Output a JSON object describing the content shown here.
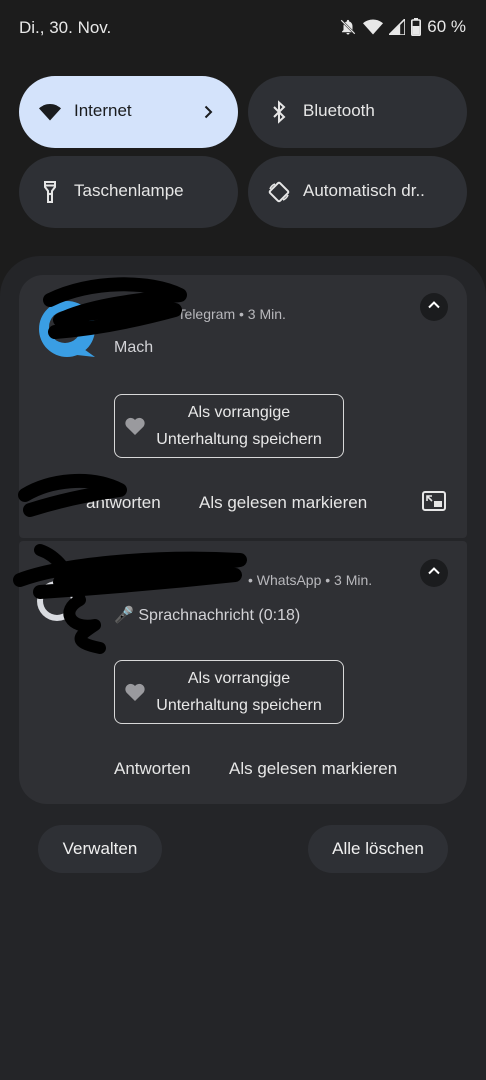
{
  "status_bar": {
    "date": "Di., 30. Nov.",
    "battery": "60 %",
    "icons": [
      "bell-off-icon",
      "wifi-icon",
      "cell-signal-icon",
      "battery-icon"
    ]
  },
  "quick_tiles": [
    {
      "label": "Internet",
      "icon": "wifi-icon",
      "active": true
    },
    {
      "label": "Bluetooth",
      "icon": "bluetooth-icon",
      "active": false
    },
    {
      "label": "Taschenlampe",
      "icon": "flashlight-icon",
      "active": false
    },
    {
      "label": "Automatisch dr..",
      "icon": "auto-rotate-icon",
      "active": false
    }
  ],
  "notifications": [
    {
      "app": "Telegram",
      "meta": "• Telegram • 3 Min.",
      "message": "Mach",
      "priority_line1": "Als vorrangige",
      "priority_line2": "Unterhaltung speichern",
      "reply": "Antworten",
      "reply_visible": "antworten",
      "mark_read": "Als gelesen markieren"
    },
    {
      "app": "WhatsApp",
      "meta": "• WhatsApp • 3 Min.",
      "message": "🎤 Sprachnachricht (0:18)",
      "priority_line1": "Als vorrangige",
      "priority_line2": "Unterhaltung speichern",
      "reply": "Antworten",
      "mark_read": "Als gelesen markieren"
    }
  ],
  "footer": {
    "manage": "Verwalten",
    "clear_all": "Alle löschen"
  },
  "colors": {
    "background": "#1c1c1c",
    "panel": "#242528",
    "card": "#2f3034",
    "tile": "#2e3035",
    "tile_active": "#d4e3fb",
    "telegram": "#3a9ee4"
  }
}
